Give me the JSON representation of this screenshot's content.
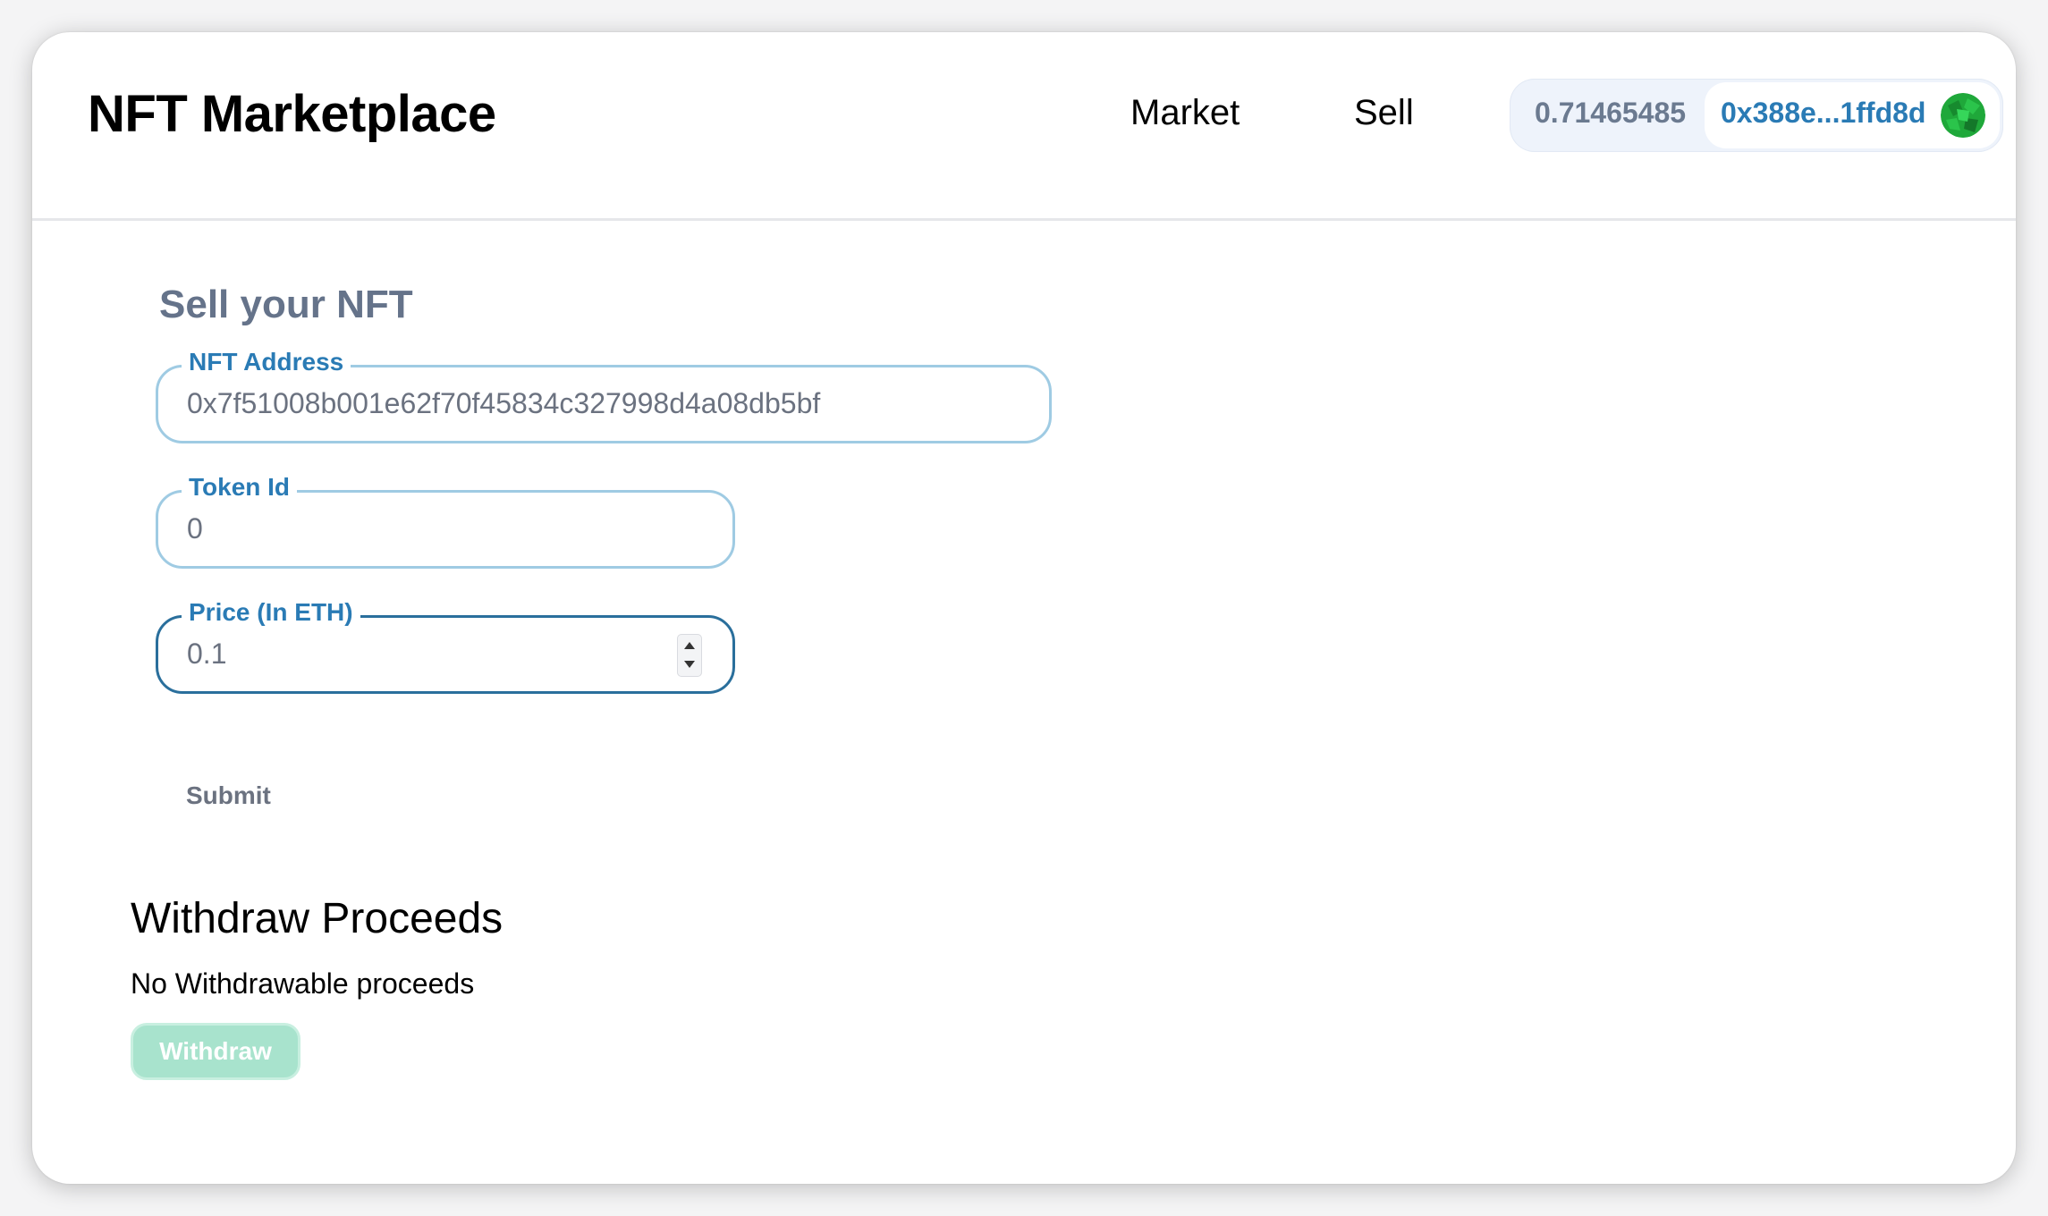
{
  "header": {
    "title": "NFT Marketplace",
    "nav": {
      "market_label": "Market",
      "sell_label": "Sell"
    },
    "wallet": {
      "balance": "0.71465485",
      "address": "0x388e...1ffd8d",
      "avatar_icon": "wallet-avatar-icon"
    }
  },
  "sell_form": {
    "title": "Sell your NFT",
    "nft_address": {
      "label": "NFT Address",
      "value": "0x7f51008b001e62f70f45834c327998d4a08db5bf"
    },
    "token_id": {
      "label": "Token Id",
      "value": "0"
    },
    "price": {
      "label": "Price (In ETH)",
      "value": "0.1"
    },
    "submit_label": "Submit"
  },
  "withdraw": {
    "title": "Withdraw Proceeds",
    "status": "No Withdrawable proceeds",
    "button_label": "Withdraw"
  },
  "colors": {
    "accent": "#2a7bb5",
    "field_border": "#9fcbe3",
    "field_border_focused": "#2a6f9c",
    "withdraw_button": "#a8e3cd",
    "avatar_green": "#1fa83a"
  }
}
